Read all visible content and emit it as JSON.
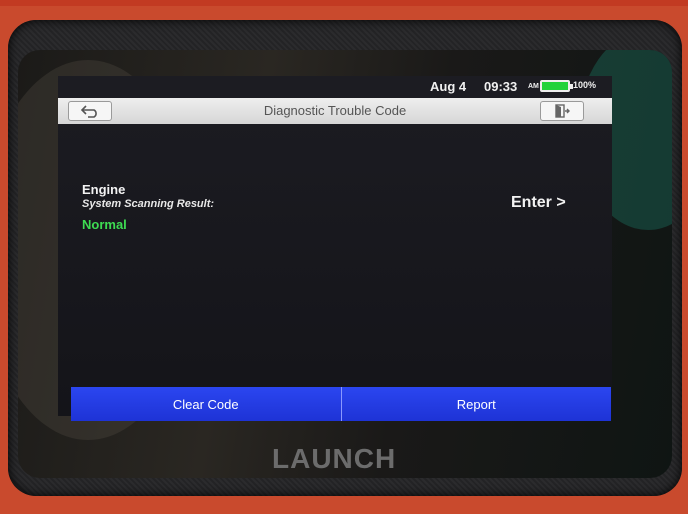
{
  "status_bar": {
    "date": "Aug 4",
    "time": "09:33",
    "ampm": "AM",
    "battery": "100%"
  },
  "header": {
    "title": "Diagnostic Trouble Code",
    "back_icon": "back-arrow-icon",
    "exit_icon": "exit-door-icon"
  },
  "result": {
    "system": "Engine",
    "label": "System Scanning Result:",
    "status": "Normal",
    "enter_label": "Enter >"
  },
  "actions": {
    "clear_label": "Clear Code",
    "report_label": "Report"
  },
  "device": {
    "brand": "LAUNCH"
  },
  "colors": {
    "accent_blue": "#1e33d6",
    "status_green": "#3ddc52",
    "device_red": "#c94a2d"
  }
}
